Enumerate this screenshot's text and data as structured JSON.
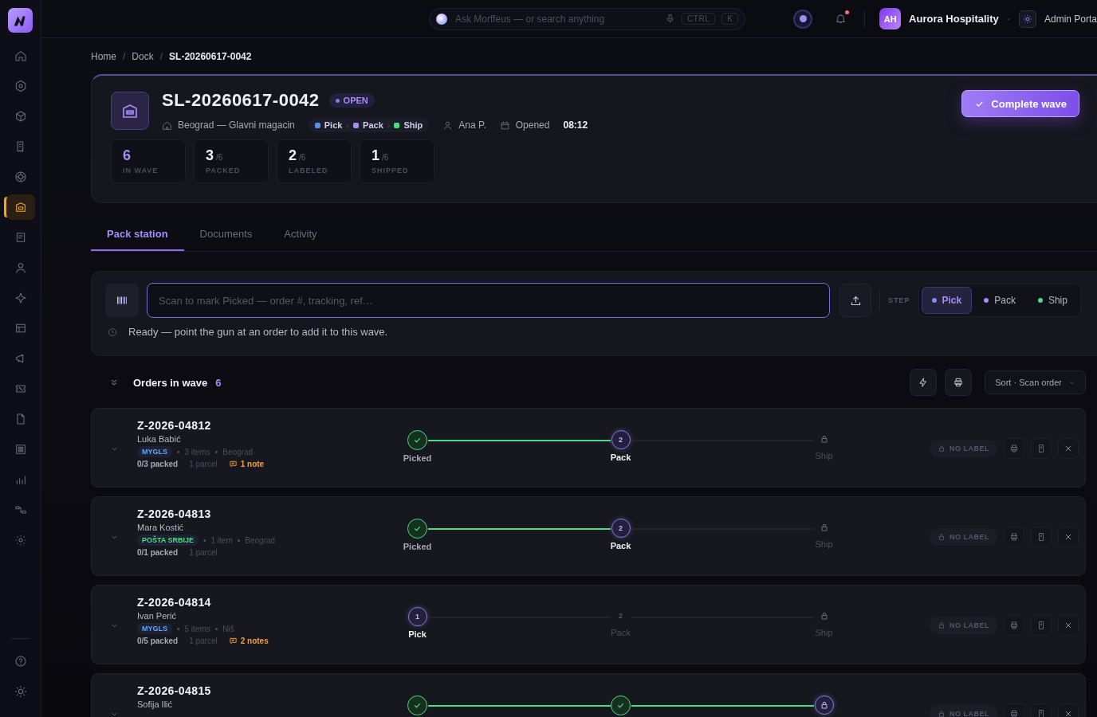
{
  "topbar": {
    "search": {
      "placeholder": "Ask Morffeus — or search anything"
    },
    "shortcut": [
      "CTRL",
      "K"
    ],
    "notifications_unread": true,
    "account": {
      "initials": "AH",
      "name": "Aurora Hospitality"
    },
    "separator": "·",
    "portal": "Admin Porta"
  },
  "sidebar": {
    "items": [
      {
        "selected": false
      },
      {
        "selected": false
      },
      {
        "selected": false
      },
      {
        "selected": false
      },
      {
        "selected": false
      },
      {
        "selected": true
      },
      {
        "selected": false
      },
      {
        "selected": false
      },
      {
        "selected": false
      },
      {
        "selected": false
      },
      {
        "selected": false
      },
      {
        "selected": false
      },
      {
        "selected": false
      },
      {
        "selected": false
      },
      {
        "selected": false
      },
      {
        "selected": false
      },
      {
        "selected": false
      }
    ]
  },
  "breadcrumb": {
    "separator": "/",
    "items": [
      {
        "label": "Home",
        "selected": false
      },
      {
        "label": "Dock",
        "selected": false
      },
      {
        "label": "SL-20260617-0042",
        "selected": true
      }
    ]
  },
  "wave": {
    "id": "SL-20260617-0042",
    "status": "OPEN",
    "location": "Beograd — Glavni magacin",
    "flow_separator": "›",
    "flow": [
      {
        "label": "Pick",
        "color": "#5b8def"
      },
      {
        "label": "Pack",
        "color": "#a78bfa"
      },
      {
        "label": "Ship",
        "color": "#4ade80"
      }
    ],
    "assignee": "Ana P.",
    "opened_label": "Opened",
    "opened_time": "08:12",
    "action": "Complete wave",
    "stats": [
      {
        "value": "6",
        "label": "IN WAVE"
      },
      {
        "value": "3",
        "total": "/6",
        "label": "PACKED"
      },
      {
        "value": "2",
        "total": "/6",
        "label": "LABELED"
      },
      {
        "value": "1",
        "total": "/6",
        "label": "SHIPPED"
      }
    ]
  },
  "tabs": [
    {
      "label": "Pack station",
      "selected": true
    },
    {
      "label": "Documents",
      "selected": false
    },
    {
      "label": "Activity",
      "selected": false
    }
  ],
  "scan": {
    "placeholder": "Scan to mark Picked — order #, tracking, ref…",
    "status": "Ready — point the gun at an order to add it to this wave.",
    "step_label": "STEP",
    "steps": [
      {
        "label": "Pick",
        "color": "#7c8cf8",
        "selected": true
      },
      {
        "label": "Pack",
        "color": "#a78bfa",
        "selected": false
      },
      {
        "label": "Ship",
        "color": "#4ade80",
        "selected": false
      }
    ]
  },
  "orders": {
    "title": "Orders in wave",
    "count": "6",
    "sort": "Sort · Scan order",
    "separator": "•",
    "items": [
      {
        "id": "Z-2026-04812",
        "customer": "Luka Babić",
        "carrier": {
          "name": "MYGLS",
          "color": "#60a5fa"
        },
        "items": "3 items",
        "city": "Beograd",
        "packed": "0/3 packed",
        "parcels": "1 parcel",
        "notes": "1 note",
        "label_status": "NO LABEL",
        "steps": [
          {
            "label": "Picked",
            "done": true,
            "current": false,
            "locked": false
          },
          {
            "label": "Pack",
            "number": "2",
            "done": false,
            "current": true,
            "locked": false
          },
          {
            "label": "Ship",
            "done": false,
            "current": false,
            "locked": true
          }
        ]
      },
      {
        "id": "Z-2026-04813",
        "customer": "Mara Kostić",
        "carrier": {
          "name": "POŠTA SRBIJE",
          "color": "#4ade80"
        },
        "items": "1 item",
        "city": "Beograd",
        "packed": "0/1 packed",
        "parcels": "1 parcel",
        "label_status": "NO LABEL",
        "steps": [
          {
            "label": "Picked",
            "done": true,
            "current": false,
            "locked": false
          },
          {
            "label": "Pack",
            "number": "2",
            "done": false,
            "current": true,
            "locked": false
          },
          {
            "label": "Ship",
            "done": false,
            "current": false,
            "locked": true
          }
        ]
      },
      {
        "id": "Z-2026-04814",
        "customer": "Ivan Perić",
        "carrier": {
          "name": "MYGLS",
          "color": "#60a5fa"
        },
        "items": "5 items",
        "city": "Niš",
        "packed": "0/5 packed",
        "parcels": "1 parcel",
        "notes": "2 notes",
        "label_status": "NO LABEL",
        "steps": [
          {
            "label": "Pick",
            "number": "1",
            "done": false,
            "current": true,
            "locked": false
          },
          {
            "label": "Pack",
            "number": "2",
            "done": false,
            "current": false,
            "locked": false
          },
          {
            "label": "Ship",
            "done": false,
            "current": false,
            "locked": true
          }
        ]
      },
      {
        "id": "Z-2026-04815",
        "customer": "Sofija Ilić",
        "label_status": "NO LABEL",
        "steps": [
          {
            "done": true,
            "current": false,
            "locked": false
          },
          {
            "done": true,
            "current": false,
            "locked": false
          },
          {
            "done": false,
            "current": true,
            "locked": true
          }
        ]
      }
    ]
  }
}
